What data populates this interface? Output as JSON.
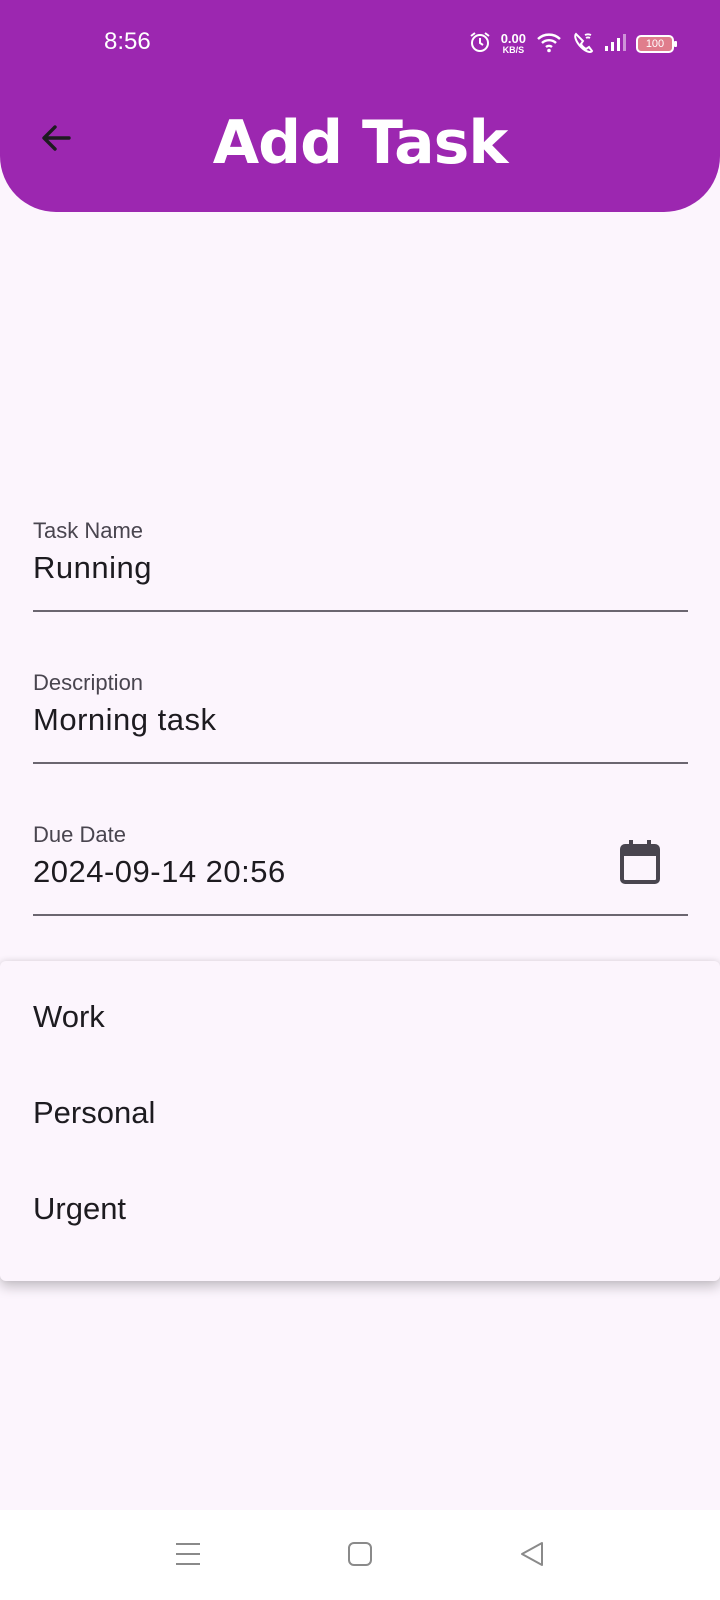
{
  "status_bar": {
    "time": "8:56",
    "net_speed": "0.00",
    "net_unit": "KB/S",
    "battery": "100"
  },
  "header": {
    "title": "Add Task",
    "back_icon": "arrow-back-icon"
  },
  "form": {
    "task_name": {
      "label": "Task Name",
      "value": "Running"
    },
    "description": {
      "label": "Description",
      "value": "Morning task"
    },
    "due_date": {
      "label": "Due Date",
      "value": "2024-09-14 20:56",
      "icon": "calendar-icon"
    }
  },
  "category_dropdown": {
    "options": [
      "Work",
      "Personal",
      "Urgent"
    ]
  },
  "nav_bar": {
    "icons": [
      "menu-icon",
      "home-square-icon",
      "back-triangle-icon"
    ]
  },
  "colors": {
    "primary": "#9c27b0",
    "background": "#fcf5fd",
    "on_surface": "#1d1b20"
  }
}
